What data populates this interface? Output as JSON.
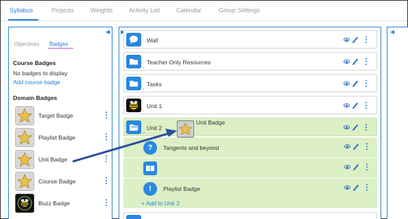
{
  "nav": {
    "tabs": [
      "Syllabus",
      "Projects",
      "Weights",
      "Activity List",
      "Calendar",
      "Group Settings"
    ]
  },
  "left": {
    "subtabs": [
      "Objectives",
      "Badges"
    ],
    "course_badges_heading": "Course Badges",
    "no_badges_text": "No badges to display",
    "add_course_badge": "Add course badge",
    "domain_badges_heading": "Domain Badges",
    "badges": [
      {
        "label": "Target Badge",
        "icon": "star-badge-icon"
      },
      {
        "label": "Playlist Badge",
        "icon": "star-badge-icon"
      },
      {
        "label": "Unit Badge",
        "icon": "star-badge-icon"
      },
      {
        "label": "Course Badge",
        "icon": "star-badge-icon"
      },
      {
        "label": "Buzz Badge",
        "icon": "bee-badge-icon"
      }
    ]
  },
  "main": {
    "rows": [
      {
        "title": "Wall",
        "icon": "chat-bubble-icon"
      },
      {
        "title": "Teacher Only Resources",
        "icon": "folder-icon"
      },
      {
        "title": "Tasks",
        "icon": "folder-icon"
      },
      {
        "title": "Unit 1",
        "icon": "bee-icon"
      },
      {
        "title": "Unit 2",
        "icon": "folder-open-icon"
      }
    ],
    "subrows": [
      {
        "title": "Tangents and beyond",
        "icon": "question-circle-icon"
      },
      {
        "title": "",
        "icon": "book-icon"
      },
      {
        "title": "Playlist Badge",
        "icon": "exclamation-circle-icon"
      }
    ],
    "add_link": "+ Add to Unit 2",
    "drag_label": "Unit Badge"
  },
  "colors": {
    "accent": "#2a7fd4",
    "highlight": "#dcefc5",
    "arrow": "#2b4f9e"
  }
}
